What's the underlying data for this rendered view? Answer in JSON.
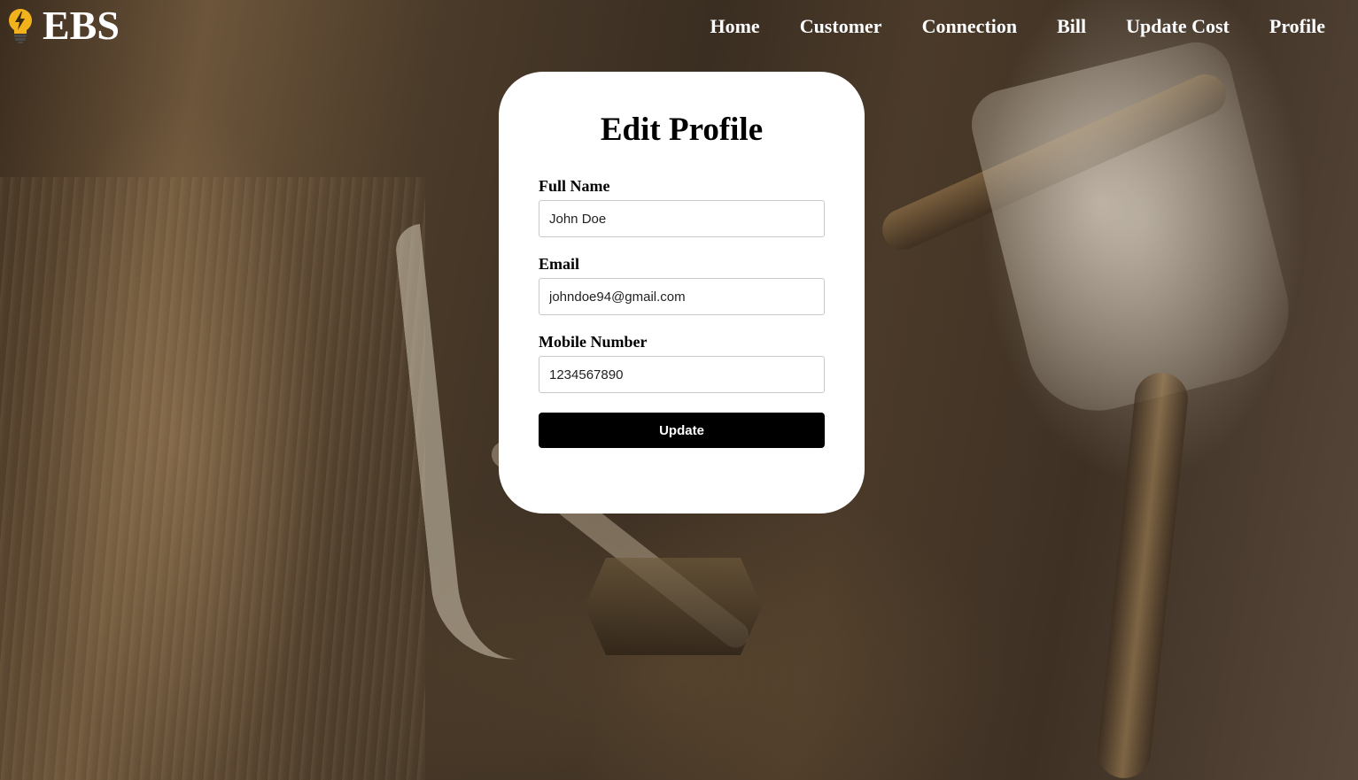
{
  "header": {
    "brand": "EBS",
    "logo_icon": "lightbulb-bolt-icon",
    "logo_color": "#f2b21c"
  },
  "nav": {
    "items": [
      {
        "label": "Home"
      },
      {
        "label": "Customer"
      },
      {
        "label": "Connection"
      },
      {
        "label": "Bill"
      },
      {
        "label": "Update Cost"
      },
      {
        "label": "Profile"
      }
    ]
  },
  "form": {
    "title": "Edit Profile",
    "full_name": {
      "label": "Full Name",
      "value": "John Doe"
    },
    "email": {
      "label": "Email",
      "value": "johndoe94@gmail.com"
    },
    "mobile": {
      "label": "Mobile Number",
      "value": "1234567890"
    },
    "submit_label": "Update"
  },
  "colors": {
    "card_background": "#ffffff",
    "button_background": "#000000",
    "nav_text": "#ffffff"
  }
}
